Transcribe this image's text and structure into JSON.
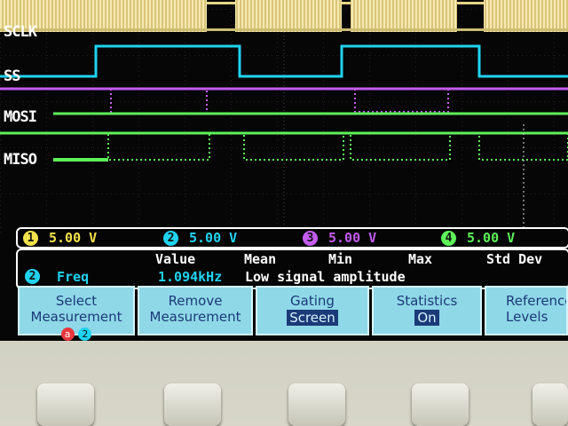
{
  "channels": {
    "ch1": {
      "name": "SCLK",
      "scale": "5.00 V",
      "number": "1",
      "color": "#f4e24b"
    },
    "ch2": {
      "name": "SS",
      "scale": "5.00 V",
      "number": "2",
      "color": "#1fd3f0"
    },
    "ch3": {
      "name": "MOSI",
      "scale": "5.00 V",
      "number": "3",
      "color": "#c45cf0"
    },
    "ch4": {
      "name": "MISO",
      "scale": "5.00 V",
      "number": "4",
      "color": "#5ef25a"
    }
  },
  "measurement": {
    "headers": {
      "value": "Value",
      "mean": "Mean",
      "min": "Min",
      "max": "Max",
      "std_dev": "Std Dev"
    },
    "source_badge": "2",
    "name": "Freq",
    "value": "1.094kHz",
    "message": "Low signal amplitude"
  },
  "menu": {
    "select": {
      "line1": "Select",
      "line2": "Measurement",
      "badge_a": "a",
      "badge_b": "2"
    },
    "remove": {
      "line1": "Remove",
      "line2": "Measurement"
    },
    "gating": {
      "line1": "Gating",
      "value": "Screen"
    },
    "statistics": {
      "line1": "Statistics",
      "value": "On"
    },
    "reference": {
      "line1": "Reference",
      "line2": "Levels"
    }
  }
}
